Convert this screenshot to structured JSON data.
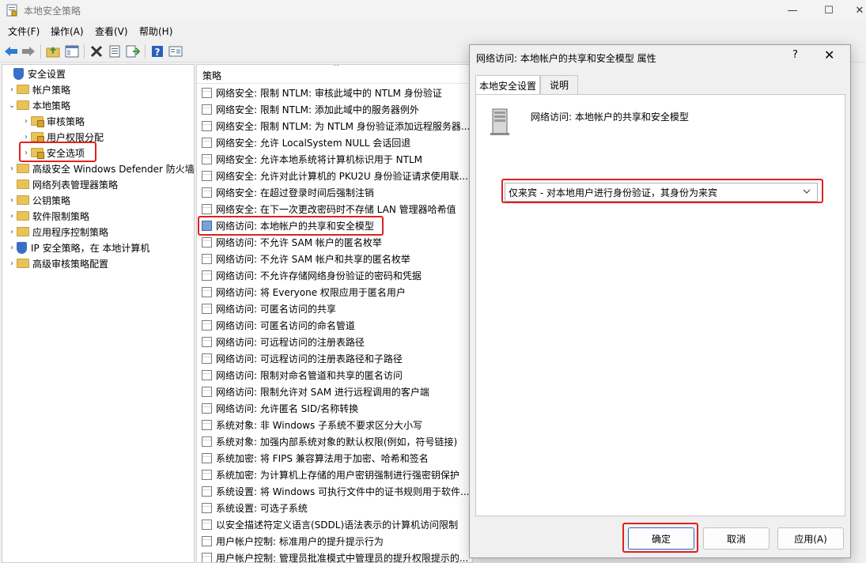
{
  "window": {
    "title": "本地安全策略"
  },
  "menu": [
    "文件(F)",
    "操作(A)",
    "查看(V)",
    "帮助(H)"
  ],
  "toolbar": [
    "back-icon",
    "forward-icon",
    "up-folder-icon",
    "show-tree-icon",
    "delete-icon",
    "properties-icon",
    "export-icon",
    "help-icon",
    "view-icon"
  ],
  "tree": [
    {
      "label": "安全设置",
      "level": 0,
      "arrow": "",
      "icon": "shield"
    },
    {
      "label": "帐户策略",
      "level": 1,
      "arrow": "›",
      "icon": "folder"
    },
    {
      "label": "本地策略",
      "level": 1,
      "arrow": "⌄",
      "icon": "folder"
    },
    {
      "label": "审核策略",
      "level": 2,
      "arrow": "›",
      "icon": "folder-lock"
    },
    {
      "label": "用户权限分配",
      "level": 2,
      "arrow": "›",
      "icon": "folder-lock"
    },
    {
      "label": "安全选项",
      "level": 2,
      "arrow": "›",
      "icon": "folder-lock"
    },
    {
      "label": "高级安全 Windows Defender 防火墙",
      "level": 1,
      "arrow": "›",
      "icon": "folder"
    },
    {
      "label": "网络列表管理器策略",
      "level": 1,
      "arrow": "",
      "icon": "folder"
    },
    {
      "label": "公钥策略",
      "level": 1,
      "arrow": "›",
      "icon": "folder"
    },
    {
      "label": "软件限制策略",
      "level": 1,
      "arrow": "›",
      "icon": "folder"
    },
    {
      "label": "应用程序控制策略",
      "level": 1,
      "arrow": "›",
      "icon": "folder"
    },
    {
      "label": "IP 安全策略，在 本地计算机",
      "level": 1,
      "arrow": "›",
      "icon": "shield"
    },
    {
      "label": "高级审核策略配置",
      "level": 1,
      "arrow": "›",
      "icon": "folder"
    }
  ],
  "list": {
    "header": "策略",
    "rows": [
      "网络安全: 限制 NTLM: 审核此域中的 NTLM 身份验证",
      "网络安全: 限制 NTLM: 添加此域中的服务器例外",
      "网络安全: 限制 NTLM: 为 NTLM 身份验证添加远程服务器...",
      "网络安全: 允许 LocalSystem NULL 会话回退",
      "网络安全: 允许本地系统将计算机标识用于 NTLM",
      "网络安全: 允许对此计算机的 PKU2U 身份验证请求使用联...",
      "网络安全: 在超过登录时间后强制注销",
      "网络安全: 在下一次更改密码时不存储 LAN 管理器哈希值",
      "网络访问: 本地帐户的共享和安全模型",
      "网络访问: 不允许 SAM 帐户的匿名枚举",
      "网络访问: 不允许 SAM 帐户和共享的匿名枚举",
      "网络访问: 不允许存储网络身份验证的密码和凭据",
      "网络访问: 将 Everyone 权限应用于匿名用户",
      "网络访问: 可匿名访问的共享",
      "网络访问: 可匿名访问的命名管道",
      "网络访问: 可远程访问的注册表路径",
      "网络访问: 可远程访问的注册表路径和子路径",
      "网络访问: 限制对命名管道和共享的匿名访问",
      "网络访问: 限制允许对 SAM 进行远程调用的客户端",
      "网络访问: 允许匿名 SID/名称转换",
      "系统对象: 非 Windows 子系统不要求区分大小写",
      "系统对象: 加强内部系统对象的默认权限(例如，符号链接)",
      "系统加密: 将 FIPS 兼容算法用于加密、哈希和签名",
      "系统加密: 为计算机上存储的用户密钥强制进行强密钥保护",
      "系统设置: 将 Windows 可执行文件中的证书规则用于软件...",
      "系统设置: 可选子系统",
      "以安全描述符定义语言(SDDL)语法表示的计算机访问限制",
      "用户帐户控制: 标准用户的提升提示行为",
      "用户帐户控制: 管理员批准模式中管理员的提升权限提示的..."
    ]
  },
  "dialog": {
    "title": "网络访问: 本地帐户的共享和安全模型 属性",
    "help": "?",
    "close": "✕",
    "tabs": [
      "本地安全设置",
      "说明"
    ],
    "policy_name": "网络访问: 本地帐户的共享和安全模型",
    "selected_value": "仅来宾 - 对本地用户进行身份验证，其身份为来宾",
    "buttons": {
      "ok": "确定",
      "cancel": "取消",
      "apply": "应用(A)"
    }
  }
}
